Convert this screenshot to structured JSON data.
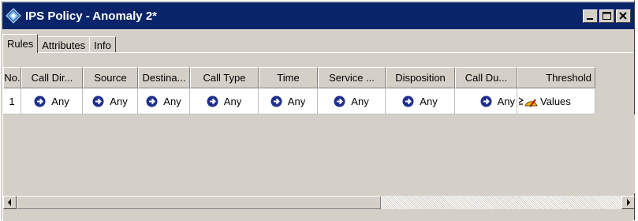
{
  "window": {
    "title": "IPS Policy - Anomaly 2*",
    "icon": "ips-policy-icon",
    "buttons": [
      "minimize-icon",
      "maximize-icon",
      "close-icon"
    ]
  },
  "tabs": [
    {
      "label": "Rules",
      "active": true
    },
    {
      "label": "Attributes",
      "active": false
    },
    {
      "label": "Info",
      "active": false
    }
  ],
  "table": {
    "columns": [
      "No.",
      "Call Dir...",
      "Source",
      "Destina...",
      "Call Type",
      "Time",
      "Service ...",
      "Disposition",
      "Call Du...",
      "Threshold"
    ],
    "rows": [
      {
        "no": "1",
        "call_dir": "Any",
        "source": "Any",
        "destination": "Any",
        "call_type": "Any",
        "time": "Any",
        "service": "Any",
        "disposition": "Any",
        "call_duration": "Any",
        "threshold": "Values"
      }
    ]
  },
  "colors": {
    "title_bar": "#0a246a",
    "face": "#d4d0c8",
    "any_icon": "#1f2f8f"
  }
}
